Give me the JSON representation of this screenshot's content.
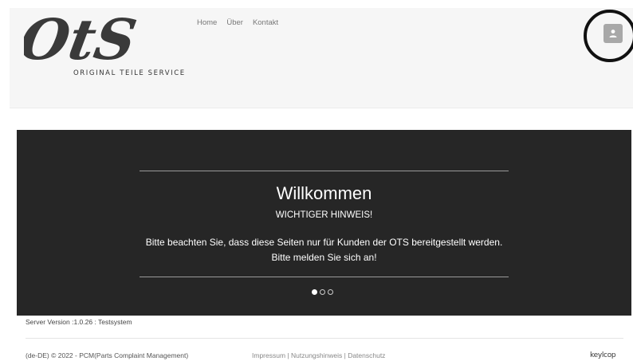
{
  "header": {
    "logo_text": "OtS",
    "logo_subtitle": "ORIGINAL TEILE SERVICE",
    "nav": [
      {
        "label": "Home"
      },
      {
        "label": "Über"
      },
      {
        "label": "Kontakt"
      }
    ],
    "user_icon": "user-icon"
  },
  "hero": {
    "title": "Willkommen",
    "subtitle": "WICHTIGER HINWEIS!",
    "text": "Bitte beachten Sie, dass diese Seiten nur für Kunden der OTS bereitgestellt werden. Bitte melden Sie sich an!",
    "slides_total": 3,
    "active_slide": 1
  },
  "server_version": "Server Version :1.0.26 : Testsystem",
  "footer": {
    "copyright": "(de-DE) © 2022 - PCM(Parts Complaint Management)",
    "links": [
      {
        "label": "Impressum"
      },
      {
        "label": "Nutzungshinweis"
      },
      {
        "label": "Datenschutz"
      }
    ],
    "separator": " | ",
    "brand": "keylcop"
  },
  "colors": {
    "hero_bg": "#262626",
    "header_bg": "#f6f6f6",
    "logo": "#3a3a3a",
    "user_button": "#a8a8a8"
  }
}
